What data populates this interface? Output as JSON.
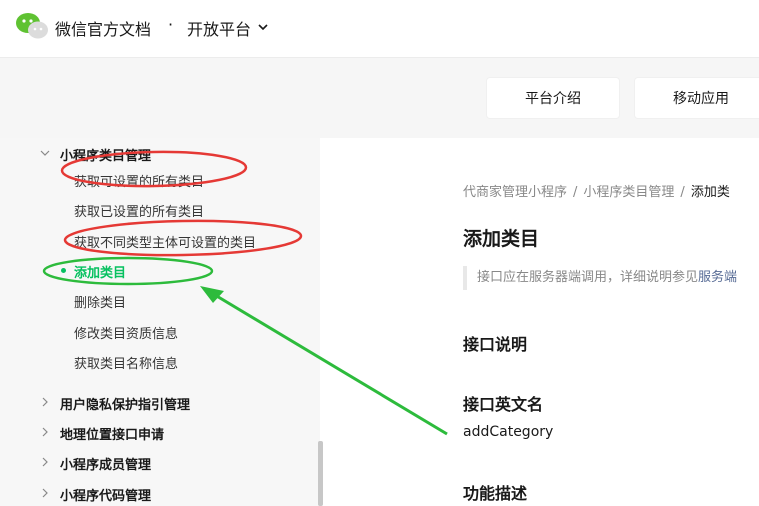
{
  "header": {
    "brand": "微信官方文档",
    "separator": "·",
    "platform": "开放平台"
  },
  "subnav": {
    "items": [
      "平台介绍",
      "移动应用"
    ]
  },
  "sidebar": {
    "group_current": "小程序类目管理",
    "items": [
      "获取可设置的所有类目",
      "获取已设置的所有类目",
      "获取不同类型主体可设置的类目",
      "添加类目",
      "删除类目",
      "修改类目资质信息",
      "获取类目名称信息"
    ],
    "active_index": 3,
    "groups_collapsed": [
      "用户隐私保护指引管理",
      "地理位置接口申请",
      "小程序成员管理",
      "小程序代码管理"
    ]
  },
  "main": {
    "breadcrumb": [
      "代商家管理小程序",
      "小程序类目管理",
      "添加类"
    ],
    "title": "添加类目",
    "note_text": "接口应在服务器端调用，详细说明参见",
    "note_link": "服务端",
    "section_api": "接口说明",
    "section_english_name": "接口英文名",
    "api_name": "addCategory",
    "section_function": "功能描述"
  },
  "colors": {
    "accent_green": "#07c160",
    "annotation_red": "#e53935",
    "annotation_green": "#2dbb3c",
    "link": "#576b95"
  }
}
